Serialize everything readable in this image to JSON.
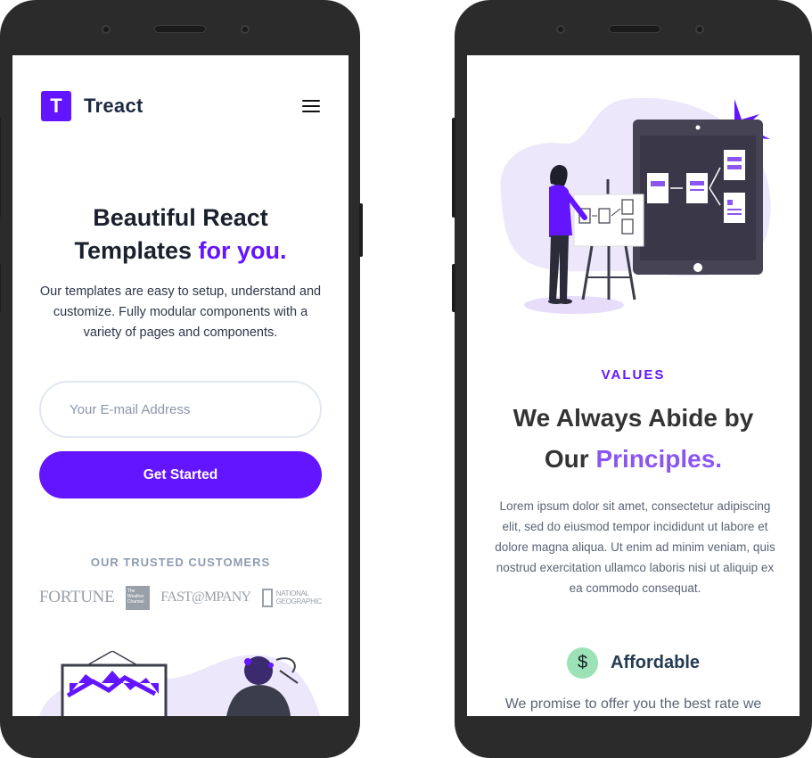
{
  "left_screen": {
    "brand": {
      "logo_letter": "T",
      "name": "Treact"
    },
    "hero": {
      "title_line1": "Beautiful React",
      "title_line2_plain": "Templates ",
      "title_line2_accent": "for you.",
      "description": "Our templates are easy to setup, understand and customize. Fully modular components with a variety of pages and components."
    },
    "signup": {
      "email_placeholder": "Your E-mail Address",
      "button_label": "Get Started"
    },
    "customers": {
      "heading": "OUR TRUSTED CUSTOMERS",
      "logos": {
        "fortune": "FORTUNE",
        "weather": "The Weather Channel",
        "fastcompany": "FAST@MPANY",
        "natgeo_line1": "NATIONAL",
        "natgeo_line2": "GEOGRAPHIC"
      }
    }
  },
  "right_screen": {
    "eyebrow": "VALUES",
    "title_line1": "We Always Abide by",
    "title_line2_plain": "Our ",
    "title_line2_accent": "Principles.",
    "description": "Lorem ipsum dolor sit amet, consectetur adipiscing elit, sed do eiusmod tempor incididunt ut labore et dolore magna aliqua. Ut enim ad minim veniam, quis nostrud exercitation ullamco laboris nisi ut aliquip ex ea commodo consequat.",
    "feature": {
      "icon_glyph": "$",
      "label": "Affordable",
      "description": "We promise to offer you the best rate we"
    }
  },
  "colors": {
    "primary": "#6415ff",
    "accent_light": "#8b56f0",
    "heading": "#1a202c",
    "muted": "#8e9bb0",
    "feature_icon_bg": "#9be3b7"
  },
  "icons": [
    "menu-icon",
    "dollar-icon",
    "camera-icon",
    "speaker-icon"
  ]
}
